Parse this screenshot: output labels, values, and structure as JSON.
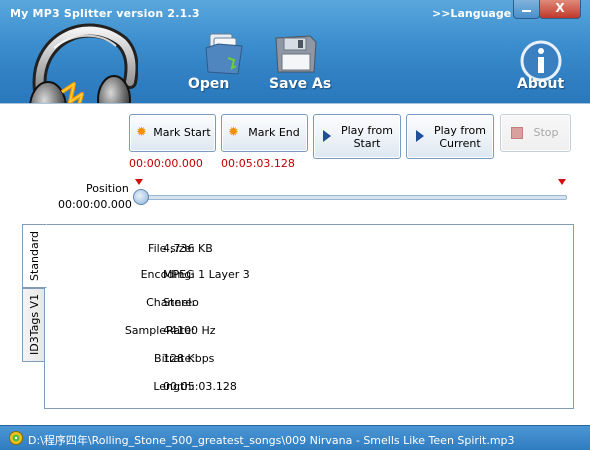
{
  "window": {
    "title": "My MP3 Splitter version 2.1.3",
    "language_link": ">>Language",
    "close_glyph": "X"
  },
  "toolbar": {
    "open_label": "Open",
    "save_as_label": "Save As",
    "about_label": "About"
  },
  "buttons": {
    "mark_start": "Mark Start",
    "mark_end": "Mark End",
    "play_from_start": [
      "Play from",
      "Start"
    ],
    "play_from_current": [
      "Play from",
      "Current"
    ],
    "stop": "Stop"
  },
  "times": {
    "mark_start": "00:00:00.000",
    "mark_end": "00:05:03.128"
  },
  "position": {
    "label": "Position",
    "time": "00:00:00.000",
    "fraction": 0
  },
  "tabs": [
    {
      "label": "Standard",
      "active": true
    },
    {
      "label": "ID3Tags V1",
      "active": false
    }
  ],
  "info": [
    {
      "label": "File size:",
      "value": "4,736 KB"
    },
    {
      "label": "Encoding:",
      "value": "MPEG 1 Layer 3"
    },
    {
      "label": "Channel:",
      "value": "Stereo"
    },
    {
      "label": "SampleRate:",
      "value": "44100 Hz"
    },
    {
      "label": "Bitrate:",
      "value": "128 Kbps"
    },
    {
      "label": "Length:",
      "value": "00:05:03.128"
    }
  ],
  "status": {
    "path": "D:\\程序四年\\Rolling_Stone_500_greatest_songs\\009 Nirvana - Smells Like Teen Spirit.mp3"
  },
  "colors": {
    "title_bar": "#3d8fce",
    "time_red": "#c00000",
    "marker_red": "#d01010",
    "status_bar": "#2e7bbf"
  }
}
